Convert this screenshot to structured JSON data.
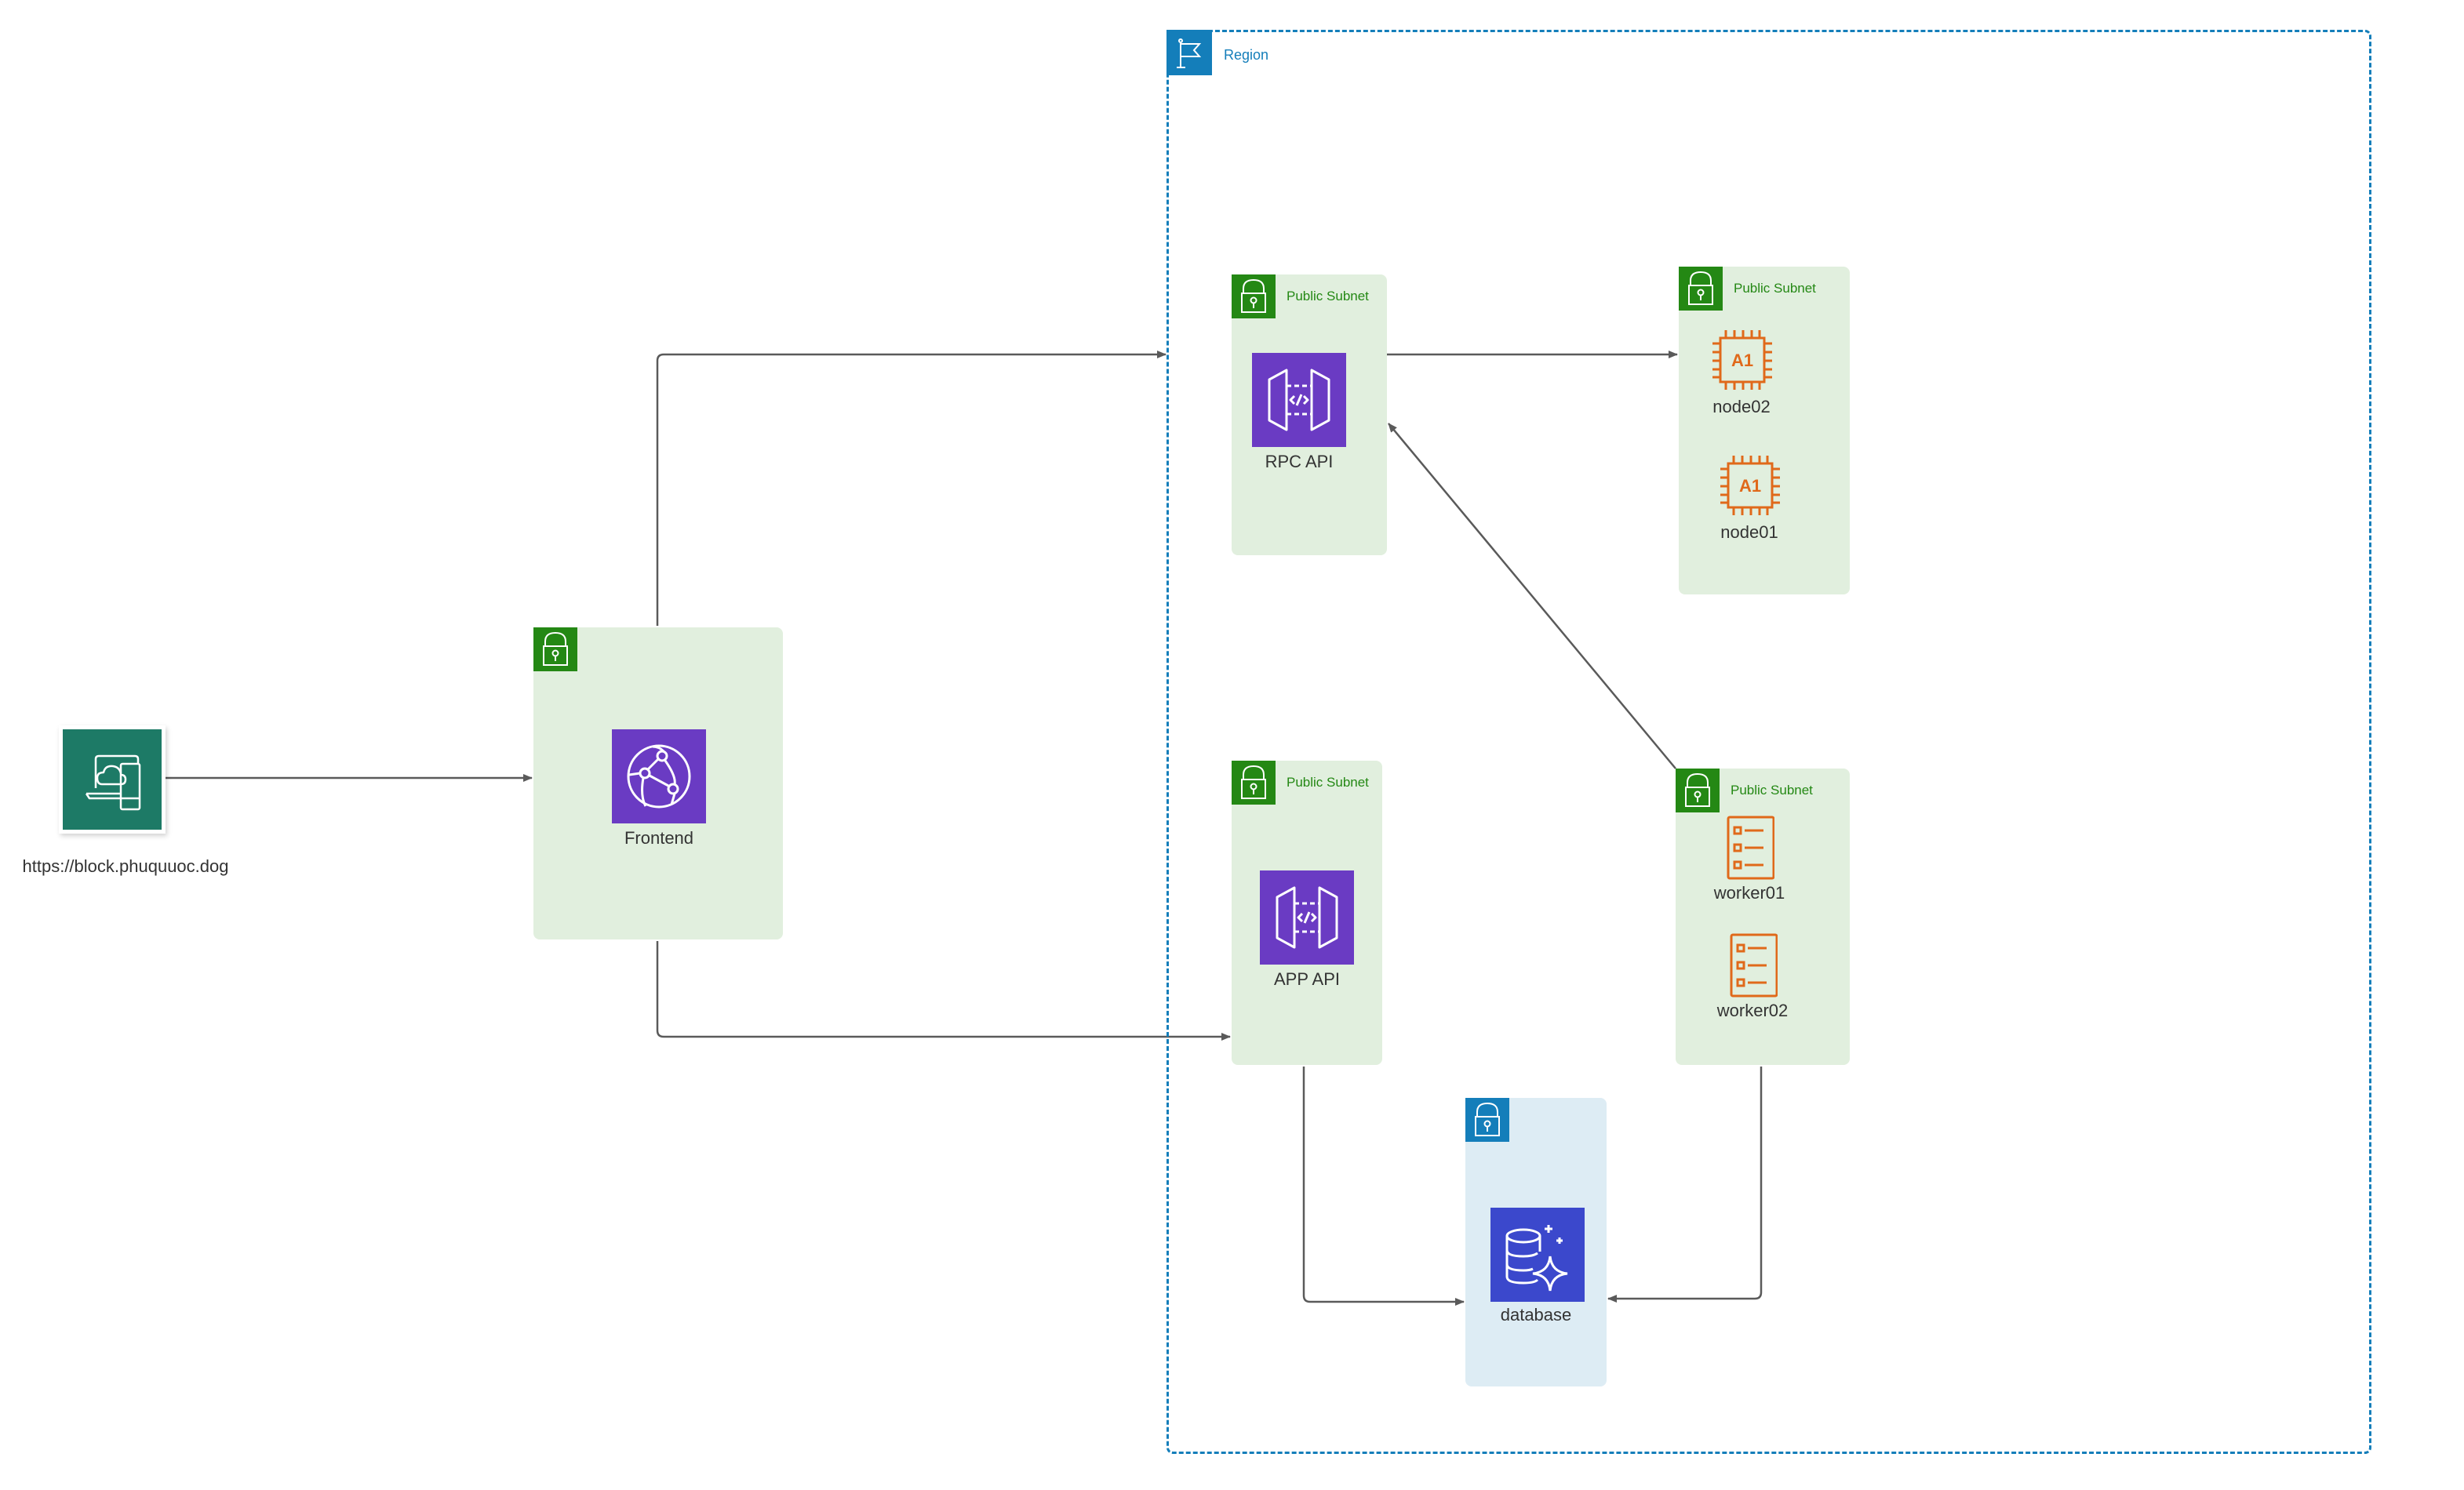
{
  "diagram": {
    "region": {
      "label": "Region",
      "icon": "flag-icon",
      "color": "#147eba"
    },
    "client": {
      "label": "https://block.phuquuoc.dog",
      "icon": "client-devices-cloud-icon",
      "color": "#1d7a66"
    },
    "subnets": [
      {
        "id": "frontend-subnet",
        "label": "",
        "icon": "lock-icon",
        "color": "#248814",
        "services": [
          {
            "label": "Frontend",
            "icon": "cloudfront-globe-icon",
            "color": "#6a3bc3"
          }
        ]
      },
      {
        "id": "rpc-subnet",
        "label": "Public Subnet",
        "icon": "lock-icon",
        "color": "#248814",
        "services": [
          {
            "label": "RPC API",
            "icon": "api-gateway-icon",
            "color": "#6a3bc3"
          }
        ]
      },
      {
        "id": "node-subnet",
        "label": "Public Subnet",
        "icon": "lock-icon",
        "color": "#248814",
        "services": [
          {
            "label": "node02",
            "icon": "a1-instance-icon",
            "color": "#e0691a"
          },
          {
            "label": "node01",
            "icon": "a1-instance-icon",
            "color": "#e0691a"
          }
        ]
      },
      {
        "id": "app-subnet",
        "label": "Public Subnet",
        "icon": "lock-icon",
        "color": "#248814",
        "services": [
          {
            "label": "APP API",
            "icon": "api-gateway-icon",
            "color": "#6a3bc3"
          }
        ]
      },
      {
        "id": "worker-subnet",
        "label": "Public Subnet",
        "icon": "lock-icon",
        "color": "#248814",
        "services": [
          {
            "label": "worker01",
            "icon": "task-list-icon",
            "color": "#e0691a"
          },
          {
            "label": "worker02",
            "icon": "task-list-icon",
            "color": "#e0691a"
          }
        ]
      },
      {
        "id": "database-subnet",
        "label": "",
        "icon": "lock-icon",
        "color": "#147eba",
        "services": [
          {
            "label": "database",
            "icon": "aurora-database-icon",
            "color": "#3b48cc"
          }
        ]
      }
    ],
    "connections": [
      {
        "from": "client",
        "to": "Frontend"
      },
      {
        "from": "Frontend",
        "to": "RPC API"
      },
      {
        "from": "Frontend",
        "to": "APP API"
      },
      {
        "from": "RPC API",
        "to": "node02"
      },
      {
        "from": "worker-subnet",
        "to": "RPC API"
      },
      {
        "from": "APP API",
        "to": "database"
      },
      {
        "from": "worker-subnet",
        "to": "database"
      }
    ]
  }
}
